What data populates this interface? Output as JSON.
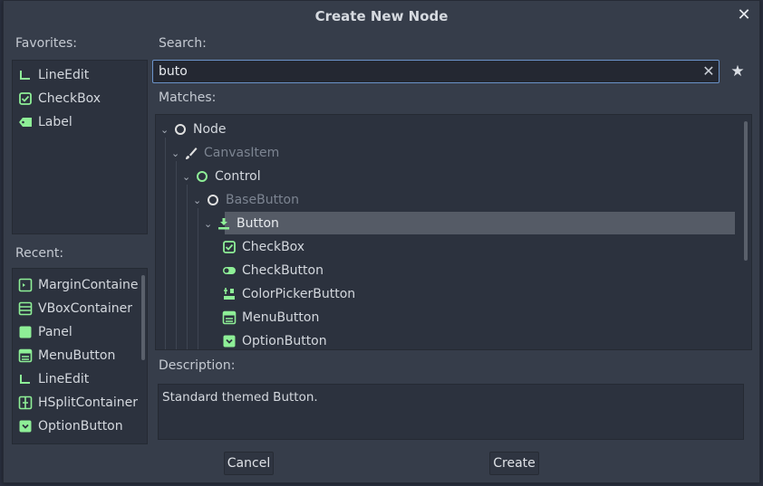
{
  "dialog": {
    "title": "Create New Node",
    "close_glyph": "✕"
  },
  "favorites": {
    "label": "Favorites:",
    "items": [
      {
        "label": "LineEdit",
        "icon": "lineedit-icon"
      },
      {
        "label": "CheckBox",
        "icon": "checkbox-icon"
      },
      {
        "label": "Label",
        "icon": "label-icon"
      }
    ]
  },
  "recent": {
    "label": "Recent:",
    "items": [
      {
        "label": "MarginContaine",
        "icon": "margincontainer-icon"
      },
      {
        "label": "VBoxContainer",
        "icon": "vboxcontainer-icon"
      },
      {
        "label": "Panel",
        "icon": "panel-icon"
      },
      {
        "label": "MenuButton",
        "icon": "menubutton-icon"
      },
      {
        "label": "LineEdit",
        "icon": "lineedit-icon"
      },
      {
        "label": "HSplitContainer",
        "icon": "hsplitcontainer-icon"
      },
      {
        "label": "OptionButton",
        "icon": "optionbutton-icon"
      }
    ]
  },
  "search": {
    "label": "Search:",
    "value": "buto",
    "clear_glyph": "✕",
    "favorite_glyph": "★"
  },
  "matches": {
    "label": "Matches:",
    "tree": [
      {
        "label": "Node",
        "icon": "node-icon",
        "dim": false
      },
      {
        "label": "CanvasItem",
        "icon": "canvasitem-icon",
        "dim": true
      },
      {
        "label": "Control",
        "icon": "control-icon",
        "dim": false
      },
      {
        "label": "BaseButton",
        "icon": "basebutton-icon",
        "dim": true
      },
      {
        "label": "Button",
        "icon": "button-icon",
        "dim": false,
        "selected": true
      },
      {
        "label": "CheckBox",
        "icon": "checkbox-icon",
        "dim": false
      },
      {
        "label": "CheckButton",
        "icon": "checkbutton-icon",
        "dim": false
      },
      {
        "label": "ColorPickerButton",
        "icon": "colorpickerbutton-icon",
        "dim": false
      },
      {
        "label": "MenuButton",
        "icon": "menubutton-icon",
        "dim": false
      },
      {
        "label": "OptionButton",
        "icon": "optionbutton-icon",
        "dim": false
      }
    ]
  },
  "description": {
    "label": "Description:",
    "text": "Standard themed Button."
  },
  "buttons": {
    "cancel": "Cancel",
    "create": "Create"
  },
  "colors": {
    "accent_green": "#8eef97",
    "background": "#363d4a",
    "panel": "#2c323e",
    "selection": "#555b66",
    "input_border": "#6b93c9"
  }
}
